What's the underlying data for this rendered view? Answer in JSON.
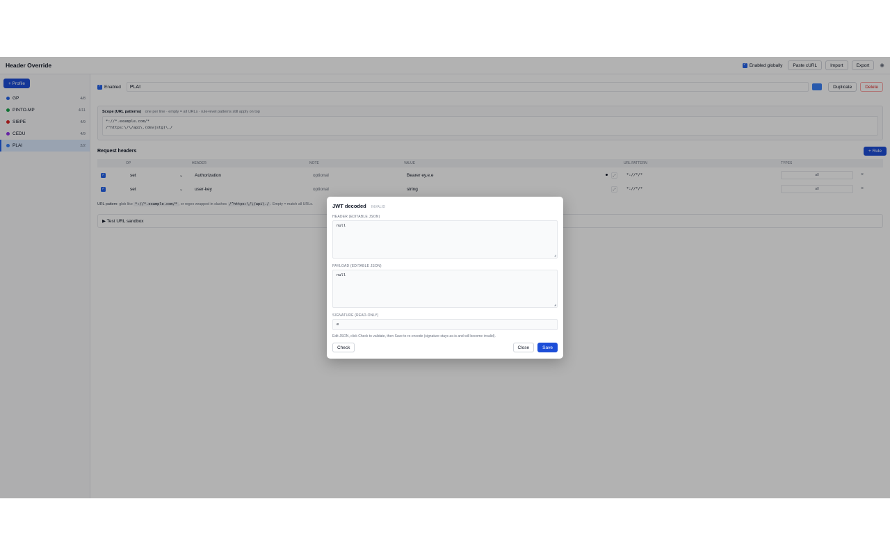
{
  "app": {
    "title": "Header Override",
    "enabled_globally_label": "Enabled globally",
    "paste_curl_label": "Paste cURL",
    "import_label": "Import",
    "export_label": "Export",
    "settings_icon": "gear-icon"
  },
  "sidebar": {
    "add_profile_label": "+ Profile",
    "profiles": [
      {
        "name": "GP",
        "count": "4/8",
        "color": "#2563eb"
      },
      {
        "name": "PINTO-MP",
        "count": "4/11",
        "color": "#16a34a"
      },
      {
        "name": "SIBPE",
        "count": "4/9",
        "color": "#dc2626"
      },
      {
        "name": "CEDU",
        "count": "4/9",
        "color": "#9333ea"
      },
      {
        "name": "PLAI",
        "count": "2/2",
        "color": "#3b82f6"
      }
    ]
  },
  "profile": {
    "enabled_label": "Enabled",
    "name": "PLAI",
    "color": "#3b82f6",
    "duplicate_label": "Duplicate",
    "delete_label": "Delete"
  },
  "scope": {
    "title": "Scope (URL patterns)",
    "hint": "one per line · empty = all URLs · rule-level patterns still apply on top",
    "line1": "*://*.example.com/*",
    "line2": "/^https:\\/\\/api\\.(dev|stg)\\./"
  },
  "request_headers": {
    "title": "Request headers",
    "add_rule_label": "+ Rule",
    "columns": {
      "op": "OP",
      "header": "HEADER",
      "note": "NOTE",
      "value": "VALUE",
      "url_pattern": "URL PATTERN",
      "types": "TYPES"
    },
    "rows": [
      {
        "op": "set",
        "header": "Authorization",
        "note": "optional",
        "value": "Bearer ey.e.e",
        "url_pattern": "*://*/*",
        "types": "all"
      },
      {
        "op": "set",
        "header": "user-key",
        "note": "optional",
        "value": "string",
        "url_pattern": "*://*/*",
        "types": "all"
      }
    ],
    "delete_glyph": "×"
  },
  "url_help": {
    "label": "URL pattern:",
    "t1": "glob like",
    "c1": "*://*.example.com/*",
    "t2": ", or regex wrapped in slashes",
    "c2": "/^https:\\/\\/api\\./",
    "t3": ". Empty = match all URLs."
  },
  "sandbox": {
    "label": "▶ Test URL sandbox"
  },
  "modal": {
    "title": "JWT decoded",
    "badge": "INVALID",
    "header_label": "HEADER (EDITABLE JSON)",
    "header_value": "null",
    "payload_label": "PAYLOAD (EDITABLE JSON)",
    "payload_value": "null",
    "signature_label": "SIGNATURE (READ-ONLY)",
    "signature_value": "e",
    "help": "Edit JSON, click Check to validate, then Save to re-encode (signature stays as-is and will become invalid).",
    "check_label": "Check",
    "close_label": "Close",
    "save_label": "Save"
  }
}
